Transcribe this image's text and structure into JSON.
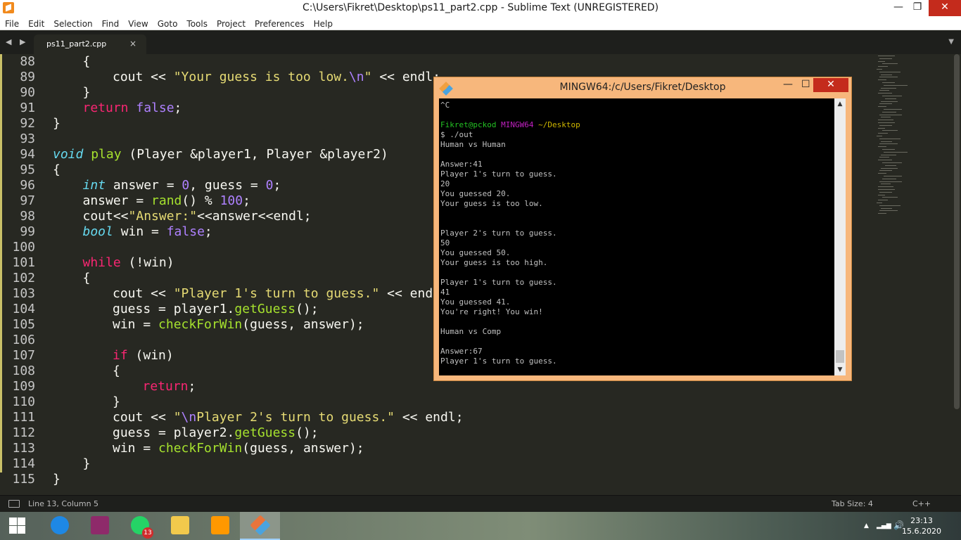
{
  "window": {
    "title": "C:\\Users\\Fikret\\Desktop\\ps11_part2.cpp - Sublime Text (UNREGISTERED)",
    "minimize": "—",
    "maximize": "❐",
    "close": "✕"
  },
  "menu": [
    "File",
    "Edit",
    "Selection",
    "Find",
    "View",
    "Goto",
    "Tools",
    "Project",
    "Preferences",
    "Help"
  ],
  "tabs": {
    "nav_arrows": "◀ ▶",
    "active_tab": "ps11_part2.cpp",
    "close_glyph": "×",
    "dropdown_glyph": "▼"
  },
  "editor": {
    "lines": [
      {
        "n": "88",
        "indent": 1,
        "tokens": [
          {
            "t": "{",
            "c": ""
          }
        ]
      },
      {
        "n": "89",
        "indent": 2,
        "tokens": [
          {
            "t": "cout << ",
            "c": ""
          },
          {
            "t": "\"Your guess is too low.",
            "c": "str"
          },
          {
            "t": "\\n",
            "c": "esc"
          },
          {
            "t": "\"",
            "c": "str"
          },
          {
            "t": " << endl;",
            "c": ""
          }
        ]
      },
      {
        "n": "90",
        "indent": 1,
        "tokens": [
          {
            "t": "}",
            "c": ""
          }
        ]
      },
      {
        "n": "91",
        "indent": 1,
        "tokens": [
          {
            "t": "return ",
            "c": "kw"
          },
          {
            "t": "false",
            "c": "num"
          },
          {
            "t": ";",
            "c": ""
          }
        ]
      },
      {
        "n": "92",
        "indent": 0,
        "tokens": [
          {
            "t": "}",
            "c": ""
          }
        ]
      },
      {
        "n": "93",
        "indent": 0,
        "tokens": []
      },
      {
        "n": "94",
        "indent": 0,
        "tokens": [
          {
            "t": "void",
            "c": "ty"
          },
          {
            "t": " ",
            "c": ""
          },
          {
            "t": "play",
            "c": "fn"
          },
          {
            "t": " (Player &player1, Player &player2)",
            "c": ""
          }
        ]
      },
      {
        "n": "95",
        "indent": 0,
        "tokens": [
          {
            "t": "{",
            "c": ""
          }
        ]
      },
      {
        "n": "96",
        "indent": 1,
        "tokens": [
          {
            "t": "int",
            "c": "ty"
          },
          {
            "t": " answer = ",
            "c": ""
          },
          {
            "t": "0",
            "c": "num"
          },
          {
            "t": ", guess = ",
            "c": ""
          },
          {
            "t": "0",
            "c": "num"
          },
          {
            "t": ";",
            "c": ""
          }
        ]
      },
      {
        "n": "97",
        "indent": 1,
        "tokens": [
          {
            "t": "answer = ",
            "c": ""
          },
          {
            "t": "rand",
            "c": "fn"
          },
          {
            "t": "() % ",
            "c": ""
          },
          {
            "t": "100",
            "c": "num"
          },
          {
            "t": ";",
            "c": ""
          }
        ]
      },
      {
        "n": "98",
        "indent": 1,
        "tokens": [
          {
            "t": "cout<<",
            "c": ""
          },
          {
            "t": "\"Answer:\"",
            "c": "str"
          },
          {
            "t": "<<answer<<endl;",
            "c": ""
          }
        ]
      },
      {
        "n": "99",
        "indent": 1,
        "tokens": [
          {
            "t": "bool",
            "c": "ty"
          },
          {
            "t": " win = ",
            "c": ""
          },
          {
            "t": "false",
            "c": "num"
          },
          {
            "t": ";",
            "c": ""
          }
        ]
      },
      {
        "n": "100",
        "indent": 0,
        "tokens": []
      },
      {
        "n": "101",
        "indent": 1,
        "tokens": [
          {
            "t": "while",
            "c": "kw"
          },
          {
            "t": " (!win)",
            "c": ""
          }
        ]
      },
      {
        "n": "102",
        "indent": 1,
        "tokens": [
          {
            "t": "{",
            "c": ""
          }
        ]
      },
      {
        "n": "103",
        "indent": 2,
        "tokens": [
          {
            "t": "cout << ",
            "c": ""
          },
          {
            "t": "\"Player 1's turn to guess.\"",
            "c": "str"
          },
          {
            "t": " << endl;",
            "c": ""
          }
        ]
      },
      {
        "n": "104",
        "indent": 2,
        "tokens": [
          {
            "t": "guess = player1.",
            "c": ""
          },
          {
            "t": "getGuess",
            "c": "fn"
          },
          {
            "t": "();",
            "c": ""
          }
        ]
      },
      {
        "n": "105",
        "indent": 2,
        "tokens": [
          {
            "t": "win = ",
            "c": ""
          },
          {
            "t": "checkForWin",
            "c": "fn"
          },
          {
            "t": "(guess, answer);",
            "c": ""
          }
        ]
      },
      {
        "n": "106",
        "indent": 0,
        "tokens": []
      },
      {
        "n": "107",
        "indent": 2,
        "tokens": [
          {
            "t": "if",
            "c": "kw"
          },
          {
            "t": " (win)",
            "c": ""
          }
        ]
      },
      {
        "n": "108",
        "indent": 2,
        "tokens": [
          {
            "t": "{",
            "c": ""
          }
        ]
      },
      {
        "n": "109",
        "indent": 3,
        "tokens": [
          {
            "t": "return",
            "c": "kw"
          },
          {
            "t": ";",
            "c": ""
          }
        ]
      },
      {
        "n": "110",
        "indent": 2,
        "tokens": [
          {
            "t": "}",
            "c": ""
          }
        ]
      },
      {
        "n": "111",
        "indent": 2,
        "tokens": [
          {
            "t": "cout << ",
            "c": ""
          },
          {
            "t": "\"",
            "c": "str"
          },
          {
            "t": "\\n",
            "c": "esc"
          },
          {
            "t": "Player 2's turn to guess.\"",
            "c": "str"
          },
          {
            "t": " << endl;",
            "c": ""
          }
        ]
      },
      {
        "n": "112",
        "indent": 2,
        "tokens": [
          {
            "t": "guess = player2.",
            "c": ""
          },
          {
            "t": "getGuess",
            "c": "fn"
          },
          {
            "t": "();",
            "c": ""
          }
        ]
      },
      {
        "n": "113",
        "indent": 2,
        "tokens": [
          {
            "t": "win = ",
            "c": ""
          },
          {
            "t": "checkForWin",
            "c": "fn"
          },
          {
            "t": "(guess, answer);",
            "c": ""
          }
        ]
      },
      {
        "n": "114",
        "indent": 1,
        "tokens": [
          {
            "t": "}",
            "c": ""
          }
        ]
      },
      {
        "n": "115",
        "indent": 0,
        "tokens": [
          {
            "t": "}",
            "c": ""
          }
        ]
      }
    ]
  },
  "statusbar": {
    "position": "Line 13, Column 5",
    "tab_size": "Tab Size: 4",
    "syntax": "C++"
  },
  "terminal": {
    "title": "MINGW64:/c/Users/Fikret/Desktop",
    "minimize": "—",
    "maximize": "☐",
    "close": "✕",
    "scroll_up": "▲",
    "scroll_down": "▼",
    "lines": [
      [
        {
          "t": "^C",
          "c": ""
        }
      ],
      [],
      [
        {
          "t": "Fikret@pckod",
          "c": "g"
        },
        {
          "t": " ",
          "c": ""
        },
        {
          "t": "MINGW64",
          "c": "m"
        },
        {
          "t": " ",
          "c": ""
        },
        {
          "t": "~/Desktop",
          "c": "y"
        }
      ],
      [
        {
          "t": "$ ./out",
          "c": ""
        }
      ],
      [
        {
          "t": "Human vs Human",
          "c": ""
        }
      ],
      [],
      [
        {
          "t": "Answer:41",
          "c": ""
        }
      ],
      [
        {
          "t": "Player 1's turn to guess.",
          "c": ""
        }
      ],
      [
        {
          "t": "20",
          "c": ""
        }
      ],
      [
        {
          "t": "You guessed 20.",
          "c": ""
        }
      ],
      [
        {
          "t": "Your guess is too low.",
          "c": ""
        }
      ],
      [],
      [],
      [
        {
          "t": "Player 2's turn to guess.",
          "c": ""
        }
      ],
      [
        {
          "t": "50",
          "c": ""
        }
      ],
      [
        {
          "t": "You guessed 50.",
          "c": ""
        }
      ],
      [
        {
          "t": "Your guess is too high.",
          "c": ""
        }
      ],
      [],
      [
        {
          "t": "Player 1's turn to guess.",
          "c": ""
        }
      ],
      [
        {
          "t": "41",
          "c": ""
        }
      ],
      [
        {
          "t": "You guessed 41.",
          "c": ""
        }
      ],
      [
        {
          "t": "You're right! You win!",
          "c": ""
        }
      ],
      [],
      [
        {
          "t": "Human vs Comp",
          "c": ""
        }
      ],
      [],
      [
        {
          "t": "Answer:67",
          "c": ""
        }
      ],
      [
        {
          "t": "Player 1's turn to guess.",
          "c": ""
        }
      ]
    ]
  },
  "taskbar": {
    "apps": [
      {
        "name": "edge-app-button",
        "icon": "edge-icon",
        "color": "#1e88e5",
        "active": false
      },
      {
        "name": "winrar-app-button",
        "icon": "winrar-icon",
        "color": "#8e2a6a",
        "active": false
      },
      {
        "name": "whatsapp-app-button",
        "icon": "whatsapp-icon",
        "color": "#25d366",
        "active": false,
        "badge": "13"
      },
      {
        "name": "file-explorer-app-button",
        "icon": "folder-icon",
        "color": "#f2c94c",
        "active": false
      },
      {
        "name": "sublime-text-app-button",
        "icon": "sublime-text-icon",
        "color": "#ff9800",
        "active": false
      },
      {
        "name": "git-bash-app-button",
        "icon": "git-bash-icon",
        "color": "#e8743b",
        "active": true
      }
    ],
    "clock_time": "23:13",
    "clock_date": "15.6.2020",
    "tray_up": "▲",
    "tray_network": "▂▄▆",
    "tray_volume": "🔊"
  }
}
